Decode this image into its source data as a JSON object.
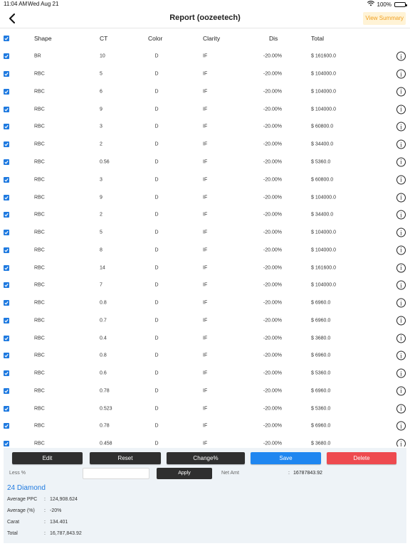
{
  "status_bar": {
    "time": "11:04 AM",
    "date": "Wed Aug 21",
    "battery": "100%"
  },
  "nav": {
    "title": "Report (oozeetech)",
    "view_summary": "View Summary"
  },
  "table": {
    "headers": {
      "shape": "Shape",
      "ct": "CT",
      "color": "Color",
      "clarity": "Clarity",
      "dis": "Dis",
      "total": "Total"
    },
    "rows": [
      {
        "shape": "BR",
        "ct": "10",
        "color": "D",
        "clarity": "IF",
        "dis": "-20.00%",
        "total": "$ 161600.0"
      },
      {
        "shape": "RBC",
        "ct": "5",
        "color": "D",
        "clarity": "IF",
        "dis": "-20.00%",
        "total": "$ 104000.0"
      },
      {
        "shape": "RBC",
        "ct": "6",
        "color": "D",
        "clarity": "IF",
        "dis": "-20.00%",
        "total": "$ 104000.0"
      },
      {
        "shape": "RBC",
        "ct": "9",
        "color": "D",
        "clarity": "IF",
        "dis": "-20.00%",
        "total": "$ 104000.0"
      },
      {
        "shape": "RBC",
        "ct": "3",
        "color": "D",
        "clarity": "IF",
        "dis": "-20.00%",
        "total": "$ 60800.0"
      },
      {
        "shape": "RBC",
        "ct": "2",
        "color": "D",
        "clarity": "IF",
        "dis": "-20.00%",
        "total": "$ 34400.0"
      },
      {
        "shape": "RBC",
        "ct": "0.56",
        "color": "D",
        "clarity": "IF",
        "dis": "-20.00%",
        "total": "$ 5360.0"
      },
      {
        "shape": "RBC",
        "ct": "3",
        "color": "D",
        "clarity": "IF",
        "dis": "-20.00%",
        "total": "$ 60800.0"
      },
      {
        "shape": "RBC",
        "ct": "9",
        "color": "D",
        "clarity": "IF",
        "dis": "-20.00%",
        "total": "$ 104000.0"
      },
      {
        "shape": "RBC",
        "ct": "2",
        "color": "D",
        "clarity": "IF",
        "dis": "-20.00%",
        "total": "$ 34400.0"
      },
      {
        "shape": "RBC",
        "ct": "5",
        "color": "D",
        "clarity": "IF",
        "dis": "-20.00%",
        "total": "$ 104000.0"
      },
      {
        "shape": "RBC",
        "ct": "8",
        "color": "D",
        "clarity": "IF",
        "dis": "-20.00%",
        "total": "$ 104000.0"
      },
      {
        "shape": "RBC",
        "ct": "14",
        "color": "D",
        "clarity": "IF",
        "dis": "-20.00%",
        "total": "$ 161600.0"
      },
      {
        "shape": "RBC",
        "ct": "7",
        "color": "D",
        "clarity": "IF",
        "dis": "-20.00%",
        "total": "$ 104000.0"
      },
      {
        "shape": "RBC",
        "ct": "0.8",
        "color": "D",
        "clarity": "IF",
        "dis": "-20.00%",
        "total": "$ 6960.0"
      },
      {
        "shape": "RBC",
        "ct": "0.7",
        "color": "D",
        "clarity": "IF",
        "dis": "-20.00%",
        "total": "$ 6960.0"
      },
      {
        "shape": "RBC",
        "ct": "0.4",
        "color": "D",
        "clarity": "IF",
        "dis": "-20.00%",
        "total": "$ 3680.0"
      },
      {
        "shape": "RBC",
        "ct": "0.8",
        "color": "D",
        "clarity": "IF",
        "dis": "-20.00%",
        "total": "$ 6960.0"
      },
      {
        "shape": "RBC",
        "ct": "0.6",
        "color": "D",
        "clarity": "IF",
        "dis": "-20.00%",
        "total": "$ 5360.0"
      },
      {
        "shape": "RBC",
        "ct": "0.78",
        "color": "D",
        "clarity": "IF",
        "dis": "-20.00%",
        "total": "$ 6960.0"
      },
      {
        "shape": "RBC",
        "ct": "0.523",
        "color": "D",
        "clarity": "IF",
        "dis": "-20.00%",
        "total": "$ 5360.0"
      },
      {
        "shape": "RBC",
        "ct": "0.78",
        "color": "D",
        "clarity": "IF",
        "dis": "-20.00%",
        "total": "$ 6960.0"
      },
      {
        "shape": "RBC",
        "ct": "0.458",
        "color": "D",
        "clarity": "IF",
        "dis": "-20.00%",
        "total": "$ 3680.0"
      }
    ]
  },
  "actions": {
    "edit": "Edit",
    "reset": "Reset",
    "change": "Change%",
    "save": "Save",
    "delete": "Delete"
  },
  "less": {
    "label": "Less %",
    "input_value": "",
    "apply": "Apply"
  },
  "net": {
    "label": "Net Amt",
    "colon": ":",
    "value": "16787843.92"
  },
  "summary": {
    "title": "24 Diamond",
    "rows": [
      {
        "label": "Average PPC",
        "colon": ":",
        "value": "124,908.624"
      },
      {
        "label": "Average (%)",
        "colon": ":",
        "value": "-20%"
      },
      {
        "label": "Carat",
        "colon": ":",
        "value": "134.401"
      },
      {
        "label": "Total",
        "colon": ":",
        "value": "16,787,843.92"
      }
    ]
  },
  "colors": {
    "accent_blue": "#1f7ae0",
    "save": "#1f86f0",
    "delete": "#ee4a4f",
    "dark_button": "#2f2f2f",
    "view_summary_text": "#f0a020",
    "view_summary_bg": "#fff3d6",
    "panel_bg": "#eef3f7"
  },
  "icons": {
    "back": "chevron-left-icon",
    "checkbox": "checkbox-checked-icon",
    "info": "info-circle-icon",
    "wifi": "wifi-icon",
    "battery": "battery-icon"
  }
}
